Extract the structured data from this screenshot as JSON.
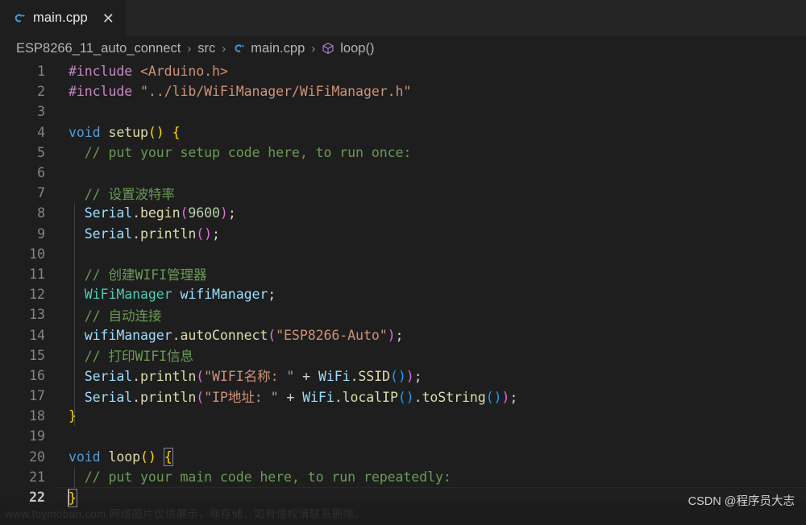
{
  "window": {
    "app": "Visual Studio Code",
    "theme_bg": "#1e1e1e",
    "tabbar_bg": "#252526"
  },
  "tab": {
    "label": "main.cpp",
    "icon": "cpp-file-icon",
    "close_glyph": "✕"
  },
  "breadcrumb": {
    "separator": "›",
    "items": [
      {
        "label": "ESP8266_11_auto_connect",
        "icon": null
      },
      {
        "label": "src",
        "icon": null
      },
      {
        "label": "main.cpp",
        "icon": "cpp-file-icon"
      },
      {
        "label": "loop()",
        "icon": "method-symbol-icon"
      }
    ]
  },
  "editor": {
    "active_line": 22,
    "total_lines": 22,
    "lines": [
      {
        "n": 1,
        "indent": 0
      },
      {
        "n": 2,
        "indent": 0
      },
      {
        "n": 3,
        "indent": 0
      },
      {
        "n": 4,
        "indent": 0
      },
      {
        "n": 5,
        "indent": 1
      },
      {
        "n": 6,
        "indent": 1
      },
      {
        "n": 7,
        "indent": 1
      },
      {
        "n": 8,
        "indent": 1
      },
      {
        "n": 9,
        "indent": 1
      },
      {
        "n": 10,
        "indent": 1
      },
      {
        "n": 11,
        "indent": 1
      },
      {
        "n": 12,
        "indent": 1
      },
      {
        "n": 13,
        "indent": 1
      },
      {
        "n": 14,
        "indent": 1
      },
      {
        "n": 15,
        "indent": 1
      },
      {
        "n": 16,
        "indent": 1
      },
      {
        "n": 17,
        "indent": 1
      },
      {
        "n": 18,
        "indent": 0
      },
      {
        "n": 19,
        "indent": 0
      },
      {
        "n": 20,
        "indent": 0
      },
      {
        "n": 21,
        "indent": 1
      },
      {
        "n": 22,
        "indent": 0
      }
    ],
    "source_text": [
      "#include <Arduino.h>",
      "#include \"../lib/WiFiManager/WiFiManager.h\"",
      "",
      "void setup() {",
      "  // put your setup code here, to run once:",
      "",
      "  // 设置波特率",
      "  Serial.begin(9600);",
      "  Serial.println();",
      "",
      "  // 创建WIFI管理器",
      "  WiFiManager wifiManager;",
      "  // 自动连接",
      "  wifiManager.autoConnect(\"ESP8266-Auto\");",
      "  // 打印WIFI信息",
      "  Serial.println(\"WIFI名称: \" + WiFi.SSID());",
      "  Serial.println(\"IP地址: \" + WiFi.localIP().toString());",
      "}",
      "",
      "void loop() {",
      "  // put your main code here, to run repeatedly:",
      "}"
    ]
  },
  "tokens": {
    "l1": {
      "pre": "#include",
      "sp": " ",
      "incl": "<Arduino.h>"
    },
    "l2": {
      "pre": "#include",
      "sp": " ",
      "incl": "\"../lib/WiFiManager/WiFiManager.h\""
    },
    "l4": {
      "kw": "void",
      "fn": "setup",
      "open": "(",
      "close": ")",
      "brace": "{"
    },
    "l5": {
      "cmt": "// put your setup code here, to run once:"
    },
    "l7": {
      "cmt": "// 设置波特率"
    },
    "l8": {
      "obj": "Serial",
      "dot": ".",
      "fn": "begin",
      "open": "(",
      "num": "9600",
      "close": ")",
      "semi": ";"
    },
    "l9": {
      "obj": "Serial",
      "dot": ".",
      "fn": "println",
      "open": "(",
      "close": ")",
      "semi": ";"
    },
    "l11": {
      "cmt": "// 创建WIFI管理器"
    },
    "l12": {
      "type": "WiFiManager",
      "var": "wifiManager",
      "semi": ";"
    },
    "l13": {
      "cmt": "// 自动连接"
    },
    "l14": {
      "obj": "wifiManager",
      "dot": ".",
      "fn": "autoConnect",
      "open": "(",
      "str": "\"ESP8266-Auto\"",
      "close": ")",
      "semi": ";"
    },
    "l15": {
      "cmt": "// 打印WIFI信息"
    },
    "l16": {
      "obj": "Serial",
      "dot": ".",
      "fn": "println",
      "open": "(",
      "str": "\"WIFI名称: \"",
      "plus": " + ",
      "obj2": "WiFi",
      "dot2": ".",
      "fn2": "SSID",
      "open2": "(",
      "close2": ")",
      "close": ")",
      "semi": ";"
    },
    "l17": {
      "obj": "Serial",
      "dot": ".",
      "fn": "println",
      "open": "(",
      "str": "\"IP地址: \"",
      "plus": " + ",
      "obj2": "WiFi",
      "dot2": ".",
      "fn2": "localIP",
      "open2": "(",
      "close2": ")",
      "dot3": ".",
      "fn3": "toString",
      "open3": "(",
      "close3": ")",
      "close": ")",
      "semi": ";"
    },
    "l18": {
      "brace": "}"
    },
    "l20": {
      "kw": "void",
      "fn": "loop",
      "open": "(",
      "close": ")",
      "brace": "{"
    },
    "l21": {
      "cmt": "// put your main code here, to run repeatedly:"
    },
    "l22": {
      "brace": "}"
    }
  },
  "watermarks": {
    "left": "www.toymoban.com 网络图片仅供展示，非存储，如有侵权请联系删除。",
    "right": "CSDN @程序员大志"
  },
  "colors": {
    "editor_bg": "#1e1e1e",
    "tabbar_bg": "#252526",
    "linenumber": "#858585",
    "linenumber_active": "#c6c6c6",
    "keyword": "#569cd6",
    "function": "#dcdcaa",
    "variable": "#9cdcfe",
    "type": "#4ec9b0",
    "string": "#ce9178",
    "number": "#b5cea8",
    "comment": "#6a9955",
    "preprocessor": "#c586c0",
    "bracket_level1": "#ffd700",
    "bracket_level2": "#da70d6",
    "bracket_level3": "#179fff"
  }
}
